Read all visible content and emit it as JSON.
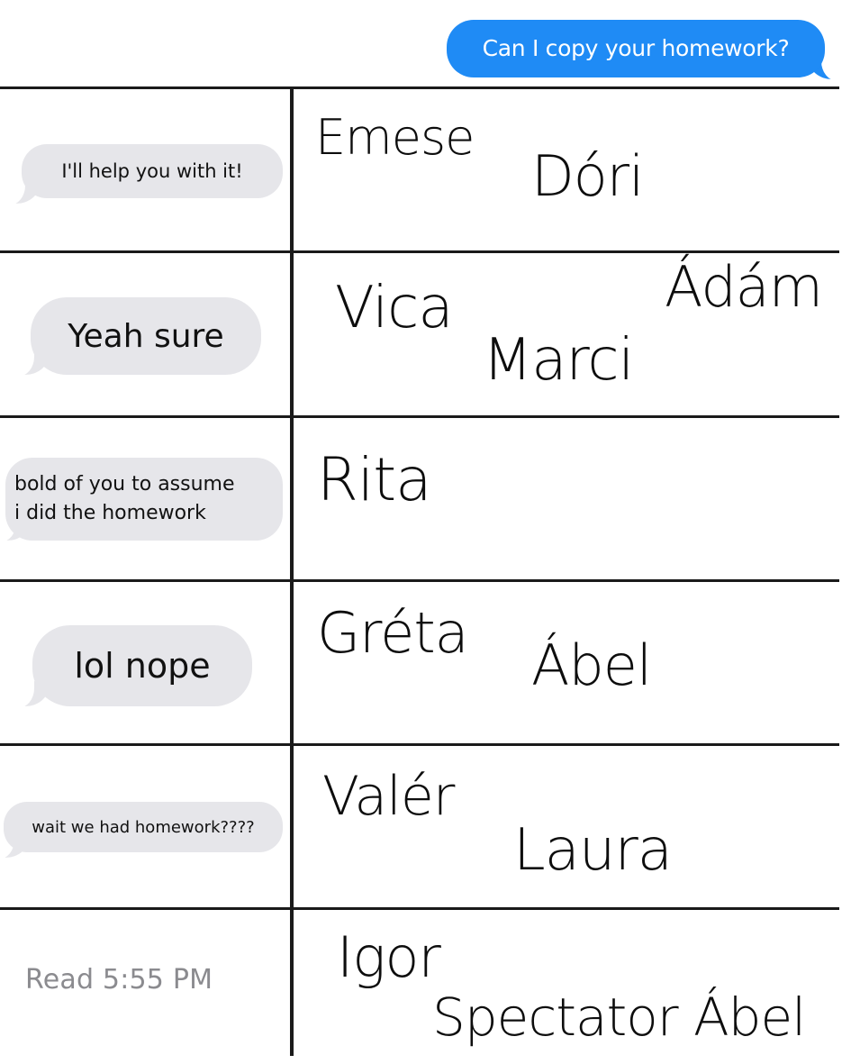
{
  "header": {
    "question": "Can I copy your homework?"
  },
  "rows": [
    {
      "reply": "I'll help you with it!",
      "names": [
        "Emese",
        "Dóri"
      ]
    },
    {
      "reply": "Yeah sure",
      "names": [
        "Vica",
        "Ádám",
        "Marci"
      ]
    },
    {
      "reply": "bold of you to assume\ni did the homework",
      "names": [
        "Rita"
      ]
    },
    {
      "reply": "lol nope",
      "names": [
        "Gréta",
        "Ábel"
      ]
    },
    {
      "reply": "wait we had homework????",
      "names": [
        "Valér",
        "Laura"
      ]
    },
    {
      "reply": "Read 5:55 PM",
      "names": [
        "Igor",
        "Spectator Ábel"
      ]
    }
  ],
  "colors": {
    "sent_bubble": "#1f8bf5",
    "received_bubble": "#e6e6ea",
    "read_receipt": "#8b8b8f",
    "grid_lines": "#1a1a1a"
  }
}
